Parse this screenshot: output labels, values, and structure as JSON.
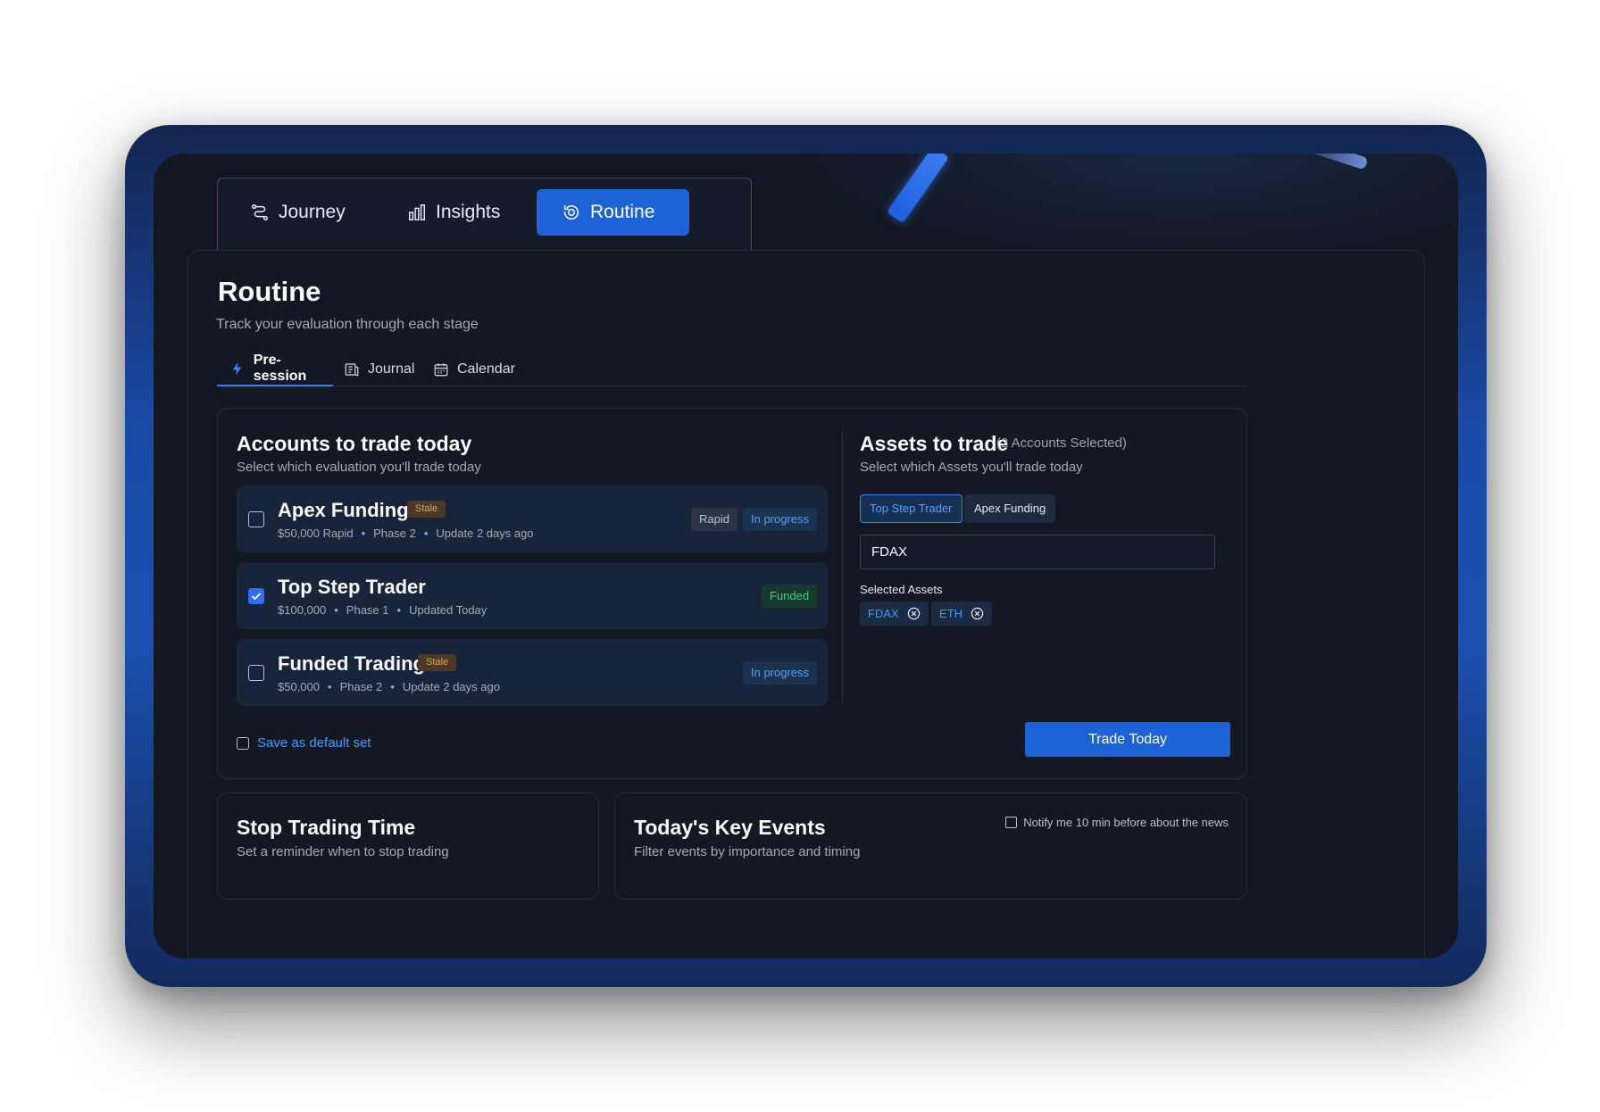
{
  "nav": {
    "journey": "Journey",
    "insights": "Insights",
    "routine": "Routine"
  },
  "page": {
    "title": "Routine",
    "subtitle": "Track your evaluation through each stage"
  },
  "tabs": {
    "presession": "Pre-session",
    "journal": "Journal",
    "calendar": "Calendar"
  },
  "accounts": {
    "title": "Accounts to trade today",
    "subtitle": "Select which evaluation you'll trade today",
    "items": [
      {
        "name": "Apex Funding",
        "stale": "Stale",
        "size": "$50,000 Rapid",
        "phase": "Phase 2",
        "updated": "Update 2 days ago",
        "badges": [
          "Rapid",
          "In progress"
        ],
        "checked": false
      },
      {
        "name": "Top Step Trader",
        "stale": "",
        "size": "$100,000",
        "phase": "Phase 1",
        "updated": "Updated Today",
        "badges": [
          "Funded"
        ],
        "checked": true
      },
      {
        "name": "Funded Trading",
        "stale": "Stale",
        "size": "$50,000",
        "phase": "Phase 2",
        "updated": "Update 2 days ago",
        "badges": [
          "In progress"
        ],
        "checked": false
      }
    ],
    "save_default": "Save as default set",
    "dot": "•"
  },
  "assets": {
    "title": "Assets to trade",
    "count": "(2 Accounts Selected)",
    "subtitle": "Select which Assets you'll trade today",
    "account_chips": [
      "Top Step Trader",
      "Apex Funding"
    ],
    "input_value": "FDAX",
    "selected_label": "Selected Assets",
    "selected": [
      "FDAX",
      "ETH"
    ]
  },
  "trade_button": "Trade Today",
  "stop_trading": {
    "title": "Stop Trading Time",
    "subtitle": "Set a reminder when to stop trading"
  },
  "key_events": {
    "title": "Today's Key Events",
    "subtitle": "Filter events by importance and timing",
    "notify": "Notify me 10 min before about the news"
  },
  "colors": {
    "accent": "#1e62d8",
    "link": "#3f9cff",
    "stale": "#e3a35a",
    "funded": "#3fd08a",
    "background": "#121722"
  }
}
